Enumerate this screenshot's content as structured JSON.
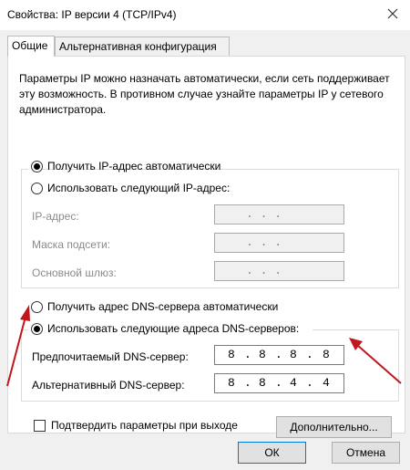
{
  "window": {
    "title": "Свойства: IP версии 4 (TCP/IPv4)",
    "close_icon": "close-icon"
  },
  "tabs": [
    {
      "label": "Общие"
    },
    {
      "label": "Альтернативная конфигурация"
    }
  ],
  "description": "Параметры IP можно назначать автоматически, если сеть поддерживает эту возможность. В противном случае узнайте параметры IP у сетевого администратора.",
  "ip_mode": {
    "auto_label": "Получить IP-адрес автоматически",
    "manual_label": "Использовать следующий IP-адрес:",
    "selected": "auto"
  },
  "ip_fields": {
    "ip_label": "IP-адрес:",
    "mask_label": "Маска подсети:",
    "gateway_label": "Основной шлюз:",
    "ip_value": ". . .",
    "mask_value": ". . .",
    "gateway_value": ". . ."
  },
  "dns_mode": {
    "auto_label": "Получить адрес DNS-сервера автоматически",
    "manual_label": "Использовать следующие адреса DNS-серверов:",
    "selected": "manual"
  },
  "dns_fields": {
    "preferred_label": "Предпочитаемый DNS-сервер:",
    "alternate_label": "Альтернативный DNS-сервер:",
    "preferred": [
      "8",
      "8",
      "8",
      "8"
    ],
    "alternate": [
      "8",
      "8",
      "4",
      "4"
    ]
  },
  "validate": {
    "label": "Подтвердить параметры при выходе",
    "checked": false
  },
  "buttons": {
    "advanced": "Дополнительно...",
    "ok": "ОК",
    "cancel": "Отмена"
  },
  "colors": {
    "arrow": "#c0161c",
    "accent": "#0078d7"
  }
}
